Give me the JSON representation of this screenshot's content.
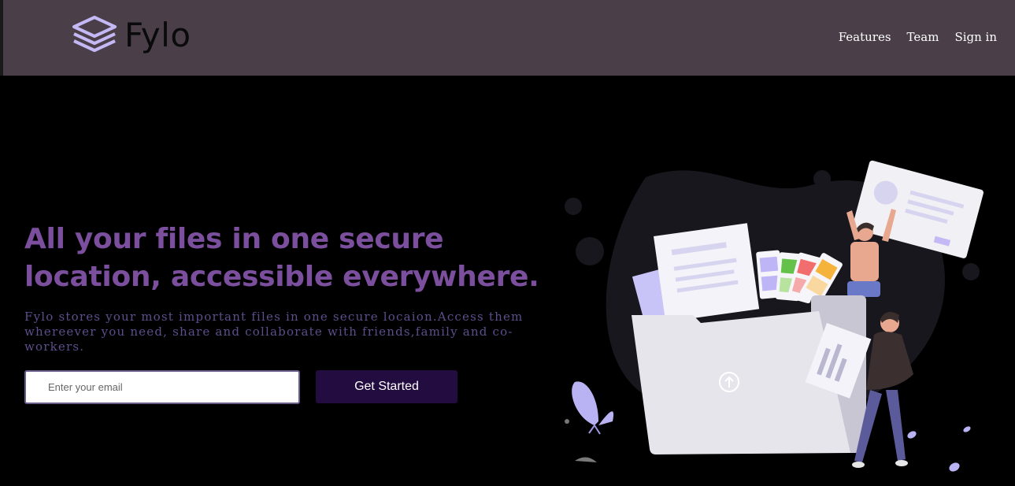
{
  "brand": {
    "name": "Fylo"
  },
  "nav": {
    "items": [
      {
        "label": "Features"
      },
      {
        "label": "Team"
      },
      {
        "label": "Sign in"
      }
    ]
  },
  "hero": {
    "headline": "All your files in one secure location, accessible everywhere.",
    "description": "Fylo stores your most important files in one secure locaion.Access them whereever you need, share and collaborate with friends,family and co-workers.",
    "email_placeholder": "Enter your email",
    "cta_label": "Get Started"
  },
  "colors": {
    "header_bg": "#4a3f49",
    "page_bg": "#000000",
    "headline": "#7b4f9e",
    "description": "#5d4e8c",
    "cta_bg": "#230c40",
    "accent": "#c4b9f5"
  },
  "icons": {
    "logo": "stacked-layers-icon",
    "upload": "upload-arrow-icon"
  }
}
